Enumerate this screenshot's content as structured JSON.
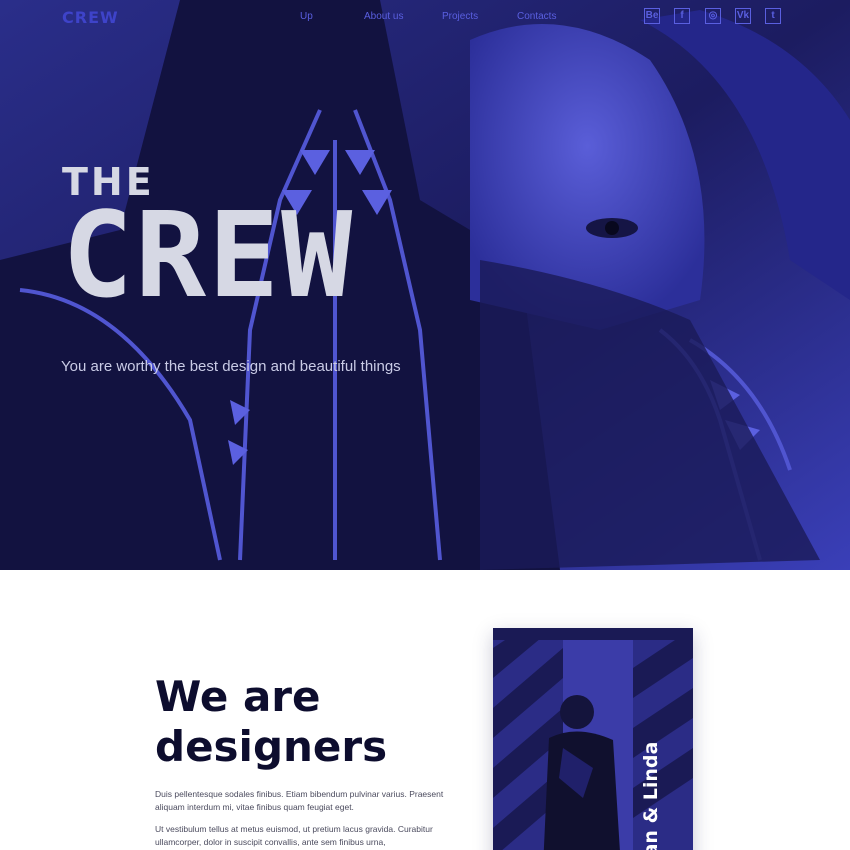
{
  "brand": "CREW",
  "nav": {
    "links": [
      "Up",
      "About us",
      "Projects",
      "Contacts"
    ],
    "social": [
      {
        "icon": "behance-icon",
        "glyph": "Be"
      },
      {
        "icon": "facebook-icon",
        "glyph": "f"
      },
      {
        "icon": "instagram-icon",
        "glyph": "◎"
      },
      {
        "icon": "vk-icon",
        "glyph": "Vk"
      },
      {
        "icon": "twitter-icon",
        "glyph": "t"
      }
    ]
  },
  "hero": {
    "small_title": "THE",
    "big_title": "CREW",
    "tagline": "You are worthy the best design and beautiful things"
  },
  "about": {
    "heading_line1": "We are",
    "heading_line2": "designers",
    "paragraph1": "Duis pellentesque sodales finibus. Etiam bibendum pulvinar varius. Praesent aliquam interdum mi, vitae finibus quam feugiat eget.",
    "paragraph2": "Ut vestibulum tellus at metus euismod, ut pretium lacus gravida. Curabitur ullamcorper, dolor in suscipit convallis, ante sem finibus urna,",
    "card_caption": "dan & Linda"
  },
  "colors": {
    "accent": "#3e43c9",
    "hero_tint": "#1a1a5a",
    "heading": "#0d0d2e"
  }
}
